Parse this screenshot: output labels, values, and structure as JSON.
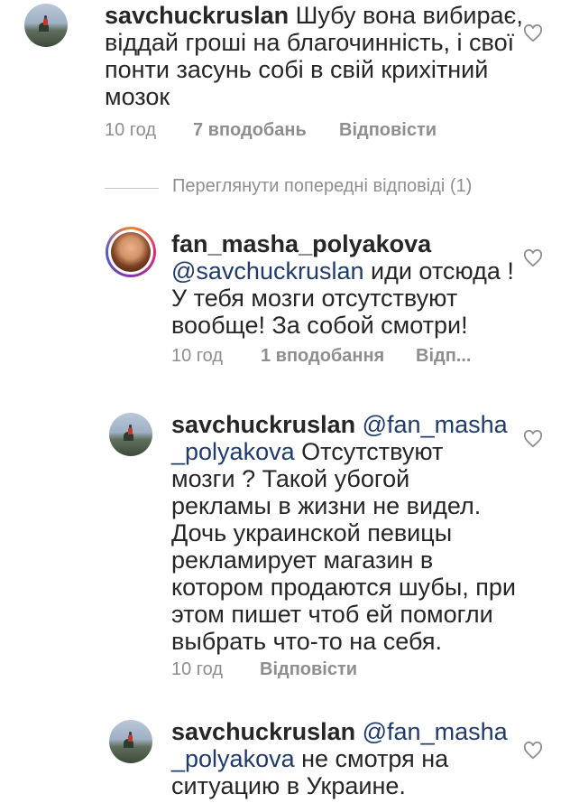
{
  "comments": [
    {
      "username": "savchuckruslan",
      "mention": "",
      "lines": [
        "Шубу вона вибирає,",
        "віддай гроші на благочинність, і свої",
        "понти засунь собі в свій крихітний",
        "мозок"
      ],
      "time": "10 год",
      "likes": "7 вподобань",
      "reply": "Відповісти"
    },
    {
      "username": "fan_masha_polyakova",
      "mention": "@savchuckruslan",
      "lines": [
        "иди отсюда !",
        "У тебя мозги отсутствуют",
        "вообще! За собой смотри!"
      ],
      "time": "10 год",
      "likes": "1 вподобання",
      "reply": "Відп..."
    },
    {
      "username": "savchuckruslan",
      "mention_part1": "@fan_masha",
      "mention_part2": "_polyakova",
      "lines": [
        "Отсутствуют",
        "мозги ? Такой убогой",
        "рекламы в жизни не видел.",
        "Дочь украинской певицы",
        "рекламирует магазин в",
        "котором продаются шубы, при",
        "этом пишет чтоб ей помогли",
        "выбрать что-то на себя."
      ],
      "time": "10 год",
      "reply": "Відповісти"
    },
    {
      "username": "savchuckruslan",
      "mention_part1": "@fan_masha",
      "mention_part2": "_polyakova",
      "lines": [
        "не смотря на",
        "ситуацию в Украине."
      ]
    }
  ],
  "view_previous_replies": "Переглянути попередні відповіді (1)",
  "icons": {
    "heart": "heart-outline-icon"
  },
  "colors": {
    "mention": "#1f3a6d",
    "meta": "#8e8e8e",
    "text": "#262626"
  }
}
